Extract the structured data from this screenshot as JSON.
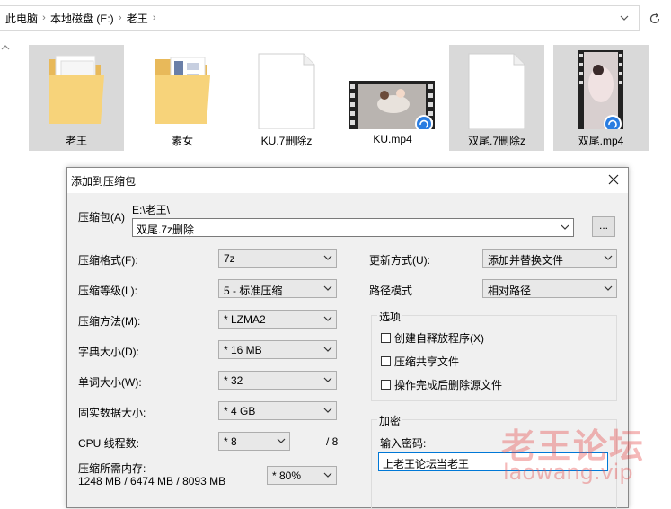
{
  "address_bar": {
    "crumbs": [
      "此电脑",
      "本地磁盘 (E:)",
      "老王"
    ]
  },
  "files": [
    {
      "name": "老王",
      "kind": "folder"
    },
    {
      "name": "素女",
      "kind": "folder"
    },
    {
      "name": "KU.7删除z",
      "kind": "blank-file"
    },
    {
      "name": "KU.mp4",
      "kind": "video"
    },
    {
      "name": "双尾.7删除z",
      "kind": "blank-file"
    },
    {
      "name": "双尾.mp4",
      "kind": "video"
    }
  ],
  "dialog": {
    "title": "添加到压缩包",
    "archive_label": "压缩包(A)",
    "archive_path": "E:\\老王\\",
    "archive_name": "双尾.7z删除",
    "browse_label": "...",
    "format_label": "压缩格式(F):",
    "format_value": "7z",
    "level_label": "压缩等级(L):",
    "level_value": "5 - 标准压缩",
    "method_label": "压缩方法(M):",
    "method_value": "* LZMA2",
    "dict_label": "字典大小(D):",
    "dict_value": "* 16 MB",
    "word_label": "单词大小(W):",
    "word_value": "* 32",
    "solid_label": "固实数据大小:",
    "solid_value": "* 4 GB",
    "threads_label": "CPU 线程数:",
    "threads_value": "* 8",
    "threads_total": "/ 8",
    "memory_label": "压缩所需内存:",
    "memory_value": "1248 MB / 6474 MB / 8093 MB",
    "memory_percent": "* 80%",
    "update_label": "更新方式(U):",
    "update_value": "添加并替换文件",
    "path_label": "路径模式",
    "path_value": "相对路径",
    "options_title": "选项",
    "options": [
      "创建自释放程序(X)",
      "压缩共享文件",
      "操作完成后删除源文件"
    ],
    "encrypt_title": "加密",
    "password_label": "输入密码:",
    "password_value": "上老王论坛当老王"
  },
  "watermark": {
    "line1": "老王论坛",
    "line2": "laowang.vip"
  },
  "colors": {
    "selection": "#cce4f7",
    "focus_border": "#0078d7",
    "watermark": "#e64646"
  }
}
